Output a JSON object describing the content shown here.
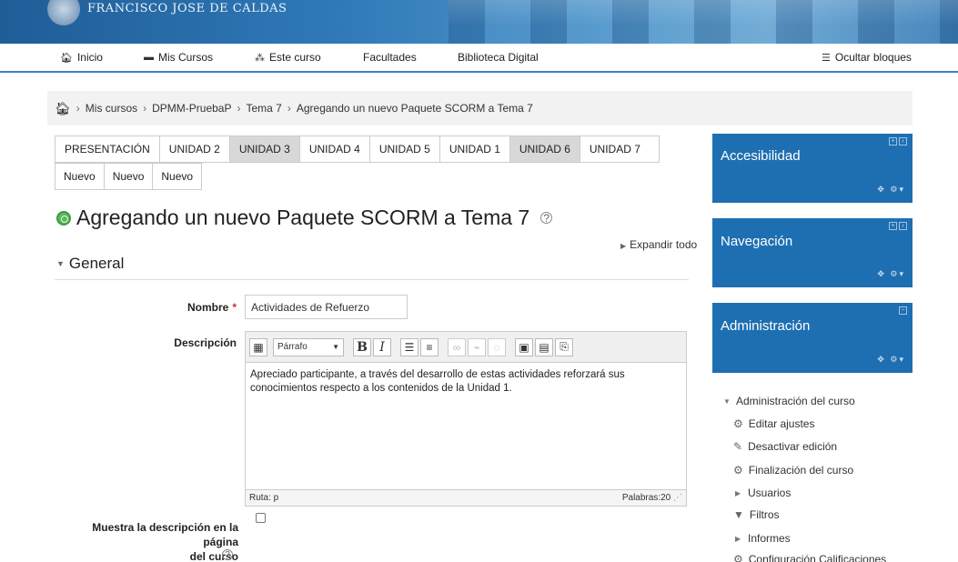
{
  "banner": {
    "university": "FRANCISCO JOSE DE CALDAS"
  },
  "nav": {
    "inicio": "Inicio",
    "mis_cursos": "Mis Cursos",
    "este_curso": "Este curso",
    "facultades": "Facultades",
    "biblioteca": "Biblioteca Digital",
    "ocultar_bloques": "Ocultar bloques"
  },
  "breadcrumb": [
    "Mis cursos",
    "DPMM-PruebaP",
    "Tema 7",
    "Agregando un nuevo Paquete SCORM a Tema 7"
  ],
  "tabs_row1": [
    {
      "label": "PRESENTACIÓN",
      "active": false
    },
    {
      "label": "UNIDAD 2",
      "active": false
    },
    {
      "label": "UNIDAD 3",
      "active": true
    },
    {
      "label": "UNIDAD 4",
      "active": false
    },
    {
      "label": "UNIDAD 5",
      "active": false
    },
    {
      "label": "UNIDAD 1",
      "active": false
    },
    {
      "label": "UNIDAD 6",
      "active": true
    },
    {
      "label": "UNIDAD 7",
      "active": false
    }
  ],
  "tabs_row2": [
    "Nuevo",
    "Nuevo",
    "Nuevo"
  ],
  "page": {
    "title": "Agregando un nuevo Paquete SCORM a Tema 7",
    "expand_all": "Expandir todo",
    "section": "General"
  },
  "form": {
    "nombre_label": "Nombre",
    "nombre_value": "Actividades de Refuerzo",
    "descripcion_label": "Descripción",
    "paragraph_select": "Párrafo",
    "description_text": "Apreciado participante, a través del desarrollo de estas actividades reforzará sus conocimientos respecto a los contenidos de la Unidad 1.",
    "path_label": "Ruta: p",
    "words_label": "Palabras:20",
    "show_desc_label_1": "Muestra la descripción en la página",
    "show_desc_label_2": "del curso"
  },
  "blocks": {
    "accesibilidad": "Accesibilidad",
    "navegacion": "Navegación",
    "administracion": "Administración"
  },
  "admin_tree": {
    "course_admin": "Administración del curso",
    "editar_ajustes": "Editar ajustes",
    "desactivar_edicion": "Desactivar edición",
    "finalizacion": "Finalización del curso",
    "usuarios": "Usuarios",
    "filtros": "Filtros",
    "informes": "Informes",
    "config_calificaciones": "Configuración Calificaciones"
  },
  "colors": {
    "brand_blue": "#1e6fb2",
    "nav_border": "#3b82c4",
    "scorm_green": "#5cb85c",
    "required": "#c9302c"
  }
}
